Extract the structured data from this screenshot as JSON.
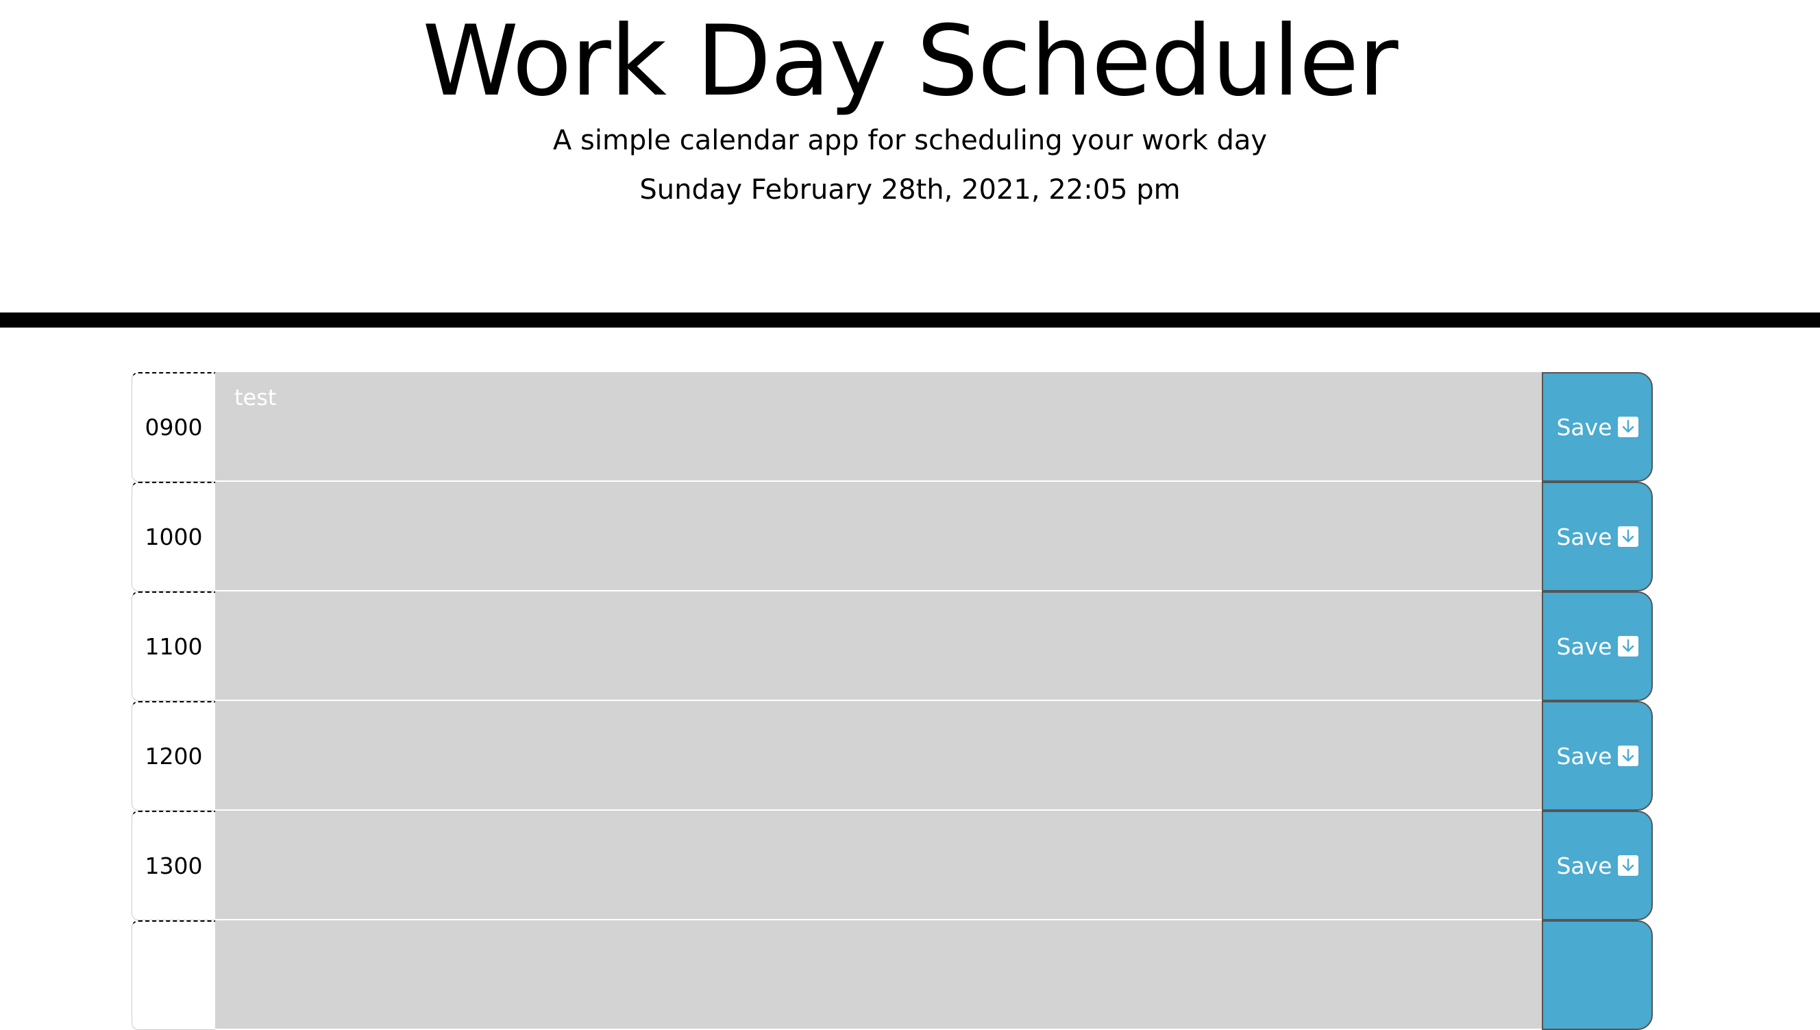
{
  "header": {
    "title": "Work Day Scheduler",
    "subtitle": "A simple calendar app for scheduling your work day",
    "current_day": "Sunday February 28th, 2021, 22:05 pm"
  },
  "rows": [
    {
      "hour": "0900",
      "text": "test",
      "save_label": "Save"
    },
    {
      "hour": "1000",
      "text": "",
      "save_label": "Save"
    },
    {
      "hour": "1100",
      "text": "",
      "save_label": "Save"
    },
    {
      "hour": "1200",
      "text": "",
      "save_label": "Save"
    },
    {
      "hour": "1300",
      "text": "",
      "save_label": "Save"
    },
    {
      "hour": "",
      "text": "",
      "save_label": ""
    }
  ],
  "colors": {
    "past": "#d3d3d3",
    "save_button": "#4aaad0"
  },
  "icons": {
    "save": "save-down-arrow-icon"
  }
}
